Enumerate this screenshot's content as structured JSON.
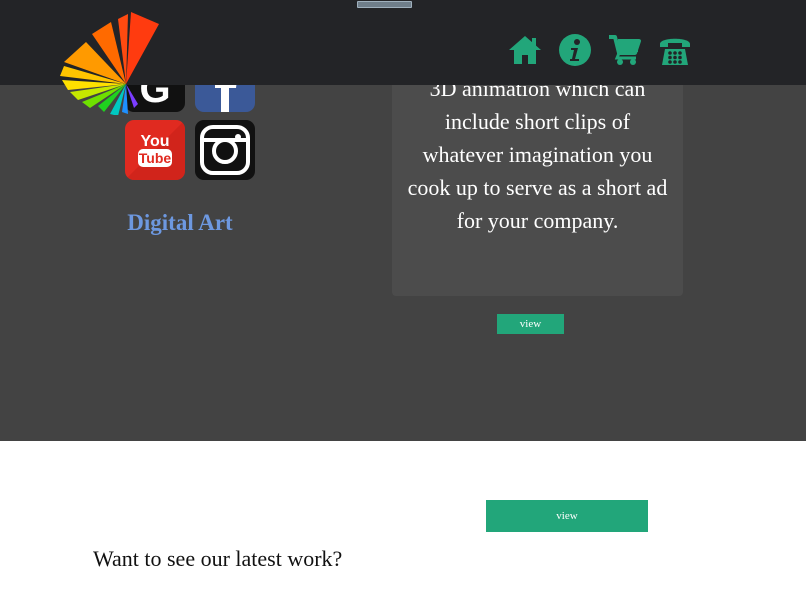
{
  "header": {
    "nav": [
      {
        "name": "home-icon"
      },
      {
        "name": "info-icon"
      },
      {
        "name": "cart-icon"
      },
      {
        "name": "phone-icon"
      }
    ],
    "colors": {
      "bar": "#232427",
      "accent": "#22a67a"
    }
  },
  "social": [
    {
      "name": "google-icon"
    },
    {
      "name": "facebook-icon"
    },
    {
      "name": "youtube-icon",
      "label_top": "You",
      "label_bottom": "Tube"
    },
    {
      "name": "instagram-icon"
    }
  ],
  "category": {
    "title": "Digital Art"
  },
  "card": {
    "description": "3D animation which can include short clips of whatever imagination you cook up to serve as a short ad for your company."
  },
  "buttons": {
    "view_1": "view",
    "view_2": "view"
  },
  "cta": {
    "text": "Want to see our latest work?"
  }
}
